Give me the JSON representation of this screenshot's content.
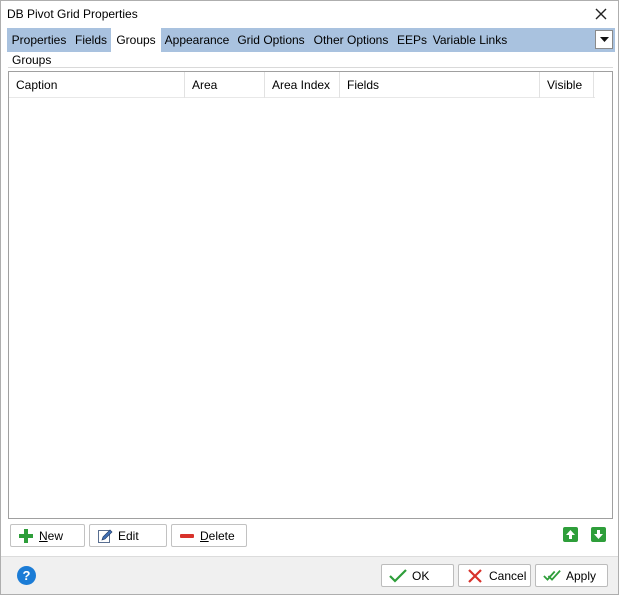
{
  "window": {
    "title": "DB Pivot Grid Properties",
    "close_icon": "close-icon"
  },
  "tabs": [
    {
      "label": "Properties",
      "active": false
    },
    {
      "label": "Fields",
      "active": false
    },
    {
      "label": "Groups",
      "active": true
    },
    {
      "label": "Appearance",
      "active": false
    },
    {
      "label": "Grid Options",
      "active": false
    },
    {
      "label": "Other Options",
      "active": false
    },
    {
      "label": "EEPs",
      "active": false
    },
    {
      "label": "Variable Links",
      "active": false
    }
  ],
  "tab_dropdown_icon": "chevron-down-icon",
  "groups": {
    "section_label": "Groups",
    "columns": [
      "Caption",
      "Area",
      "Area Index",
      "Fields",
      "Visible"
    ],
    "rows": []
  },
  "actions": {
    "new_label_prefix": "",
    "new_label_underline": "N",
    "new_label_rest": "ew",
    "edit_label": "Edit",
    "delete_label_underline": "D",
    "delete_label_rest": "elete",
    "new_icon": "plus-icon",
    "edit_icon": "pencil-edit-icon",
    "delete_icon": "minus-icon",
    "move_up_icon": "arrow-up-icon",
    "move_down_icon": "arrow-down-icon"
  },
  "footer": {
    "help_icon": "help-icon",
    "help_glyph": "?",
    "ok_label": "OK",
    "cancel_label": "Cancel",
    "apply_label": "Apply"
  },
  "colors": {
    "tab_strip": "#a9c2df",
    "accent_green": "#2e9e3a",
    "cancel_red": "#d8322b",
    "help_blue": "#1b7cd6"
  }
}
